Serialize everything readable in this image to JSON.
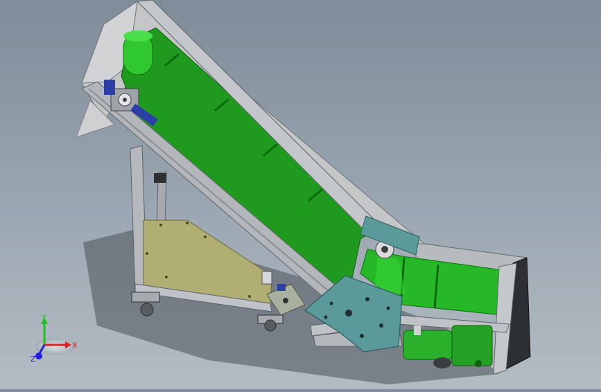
{
  "axes": {
    "x_label": "X",
    "y_label": "Y",
    "z_label": "Z"
  },
  "colors": {
    "background_top": "#7f8c99",
    "background_bottom": "#b4bcc3",
    "belt_green": "#1f9a1f",
    "belt_green_light": "#35d135",
    "frame_gray": "#b9bcc0",
    "panel_gray": "#c9c9c9",
    "plate_teal": "#5a9a9a",
    "base_khaki": "#b0ae72",
    "guard_blue": "#2c3fa8",
    "motor_green": "#2bb02b",
    "x_axis": "#e02020",
    "y_axis": "#20c020",
    "z_axis": "#2020e0"
  }
}
